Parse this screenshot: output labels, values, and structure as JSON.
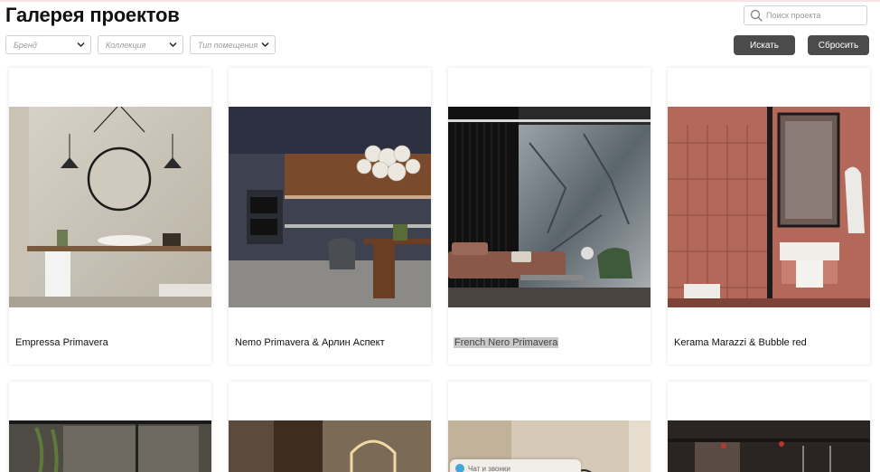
{
  "page": {
    "title": "Галерея проектов"
  },
  "search": {
    "placeholder": "Поиск проекта"
  },
  "filters": [
    {
      "label": "Бренд"
    },
    {
      "label": "Коллекция"
    },
    {
      "label": "Тип помещения"
    }
  ],
  "buttons": {
    "search": "Искать",
    "reset": "Сбросить"
  },
  "projects": [
    {
      "name": "Empressa Primavera"
    },
    {
      "name": "Nemo Primavera & Арлин Аспект"
    },
    {
      "name": "French Nero Primavera"
    },
    {
      "name": "Kerama Marazzi & Bubble red"
    }
  ],
  "chat_widget": {
    "label": "Чат и звонки"
  },
  "colors": {
    "button_bg": "#4b4b4b",
    "selection": "#c9c9c9"
  }
}
